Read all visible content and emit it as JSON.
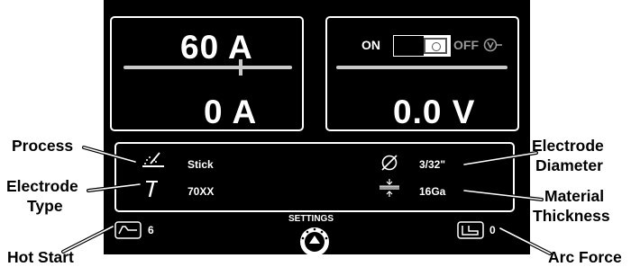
{
  "current_panel": {
    "set_current": "60 A",
    "actual_current": "0 A"
  },
  "voltage_panel": {
    "vrd_on": "ON",
    "vrd_off": "OFF",
    "voltage": "0.0 V"
  },
  "settings": {
    "process": "Stick",
    "electrode_type": "70XX",
    "electrode_diameter": "3/32\"",
    "material_thickness": "16Ga",
    "hot_start_value": "6",
    "arc_force_value": "0",
    "settings_label": "SETTINGS"
  },
  "callouts": {
    "process": "Process",
    "electrode_type_line1": "Electrode",
    "electrode_type_line2": "Type",
    "hot_start": "Hot Start",
    "electrode_diameter_line1": "Electrode",
    "electrode_diameter_line2": "Diameter",
    "material_thickness_line1": "Material",
    "material_thickness_line2": "Thickness",
    "arc_force": "Arc Force"
  },
  "colors": {
    "screen": "#000000",
    "text": "#ffffff",
    "slider": "#c9c9c9",
    "panel_border": "#ffffff"
  },
  "icons": [
    "stick-process-icon",
    "electrode-icon",
    "diameter-icon",
    "material-thickness-icon",
    "hot-start-icon",
    "arc-force-icon",
    "settings-knob-icon",
    "vrd-icon"
  ]
}
